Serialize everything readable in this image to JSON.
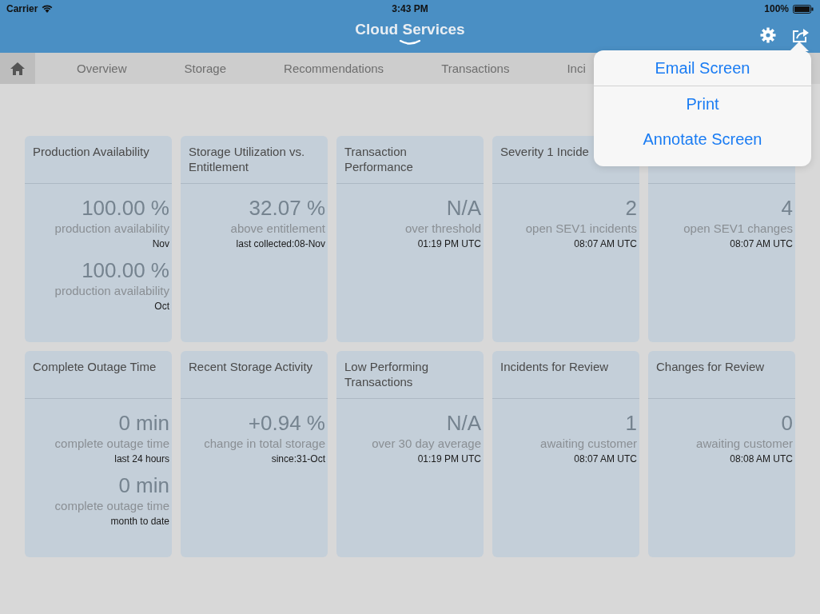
{
  "status_bar": {
    "carrier": "Carrier",
    "time": "3:43 PM",
    "battery": "100%"
  },
  "header": {
    "title": "Cloud Services"
  },
  "tabs": [
    {
      "kind": "home",
      "selected": true
    },
    {
      "kind": "text",
      "label": "Overview",
      "selected": false
    },
    {
      "kind": "text",
      "label": "Storage",
      "selected": false
    },
    {
      "kind": "text",
      "label": "Recommendations",
      "selected": false
    },
    {
      "kind": "text",
      "label": "Transactions",
      "selected": false
    },
    {
      "kind": "text",
      "label": "Inci",
      "selected": false
    }
  ],
  "cards": [
    {
      "title": "Production Availability",
      "metrics": [
        {
          "value": "100.00 %",
          "label": "production availability",
          "note": "Nov"
        },
        {
          "value": "100.00 %",
          "label": "production availability",
          "note": "Oct"
        }
      ]
    },
    {
      "title": "Storage Utilization vs. Entitlement",
      "metrics": [
        {
          "value": "32.07 %",
          "label": "above entitlement",
          "note": "last collected:08-Nov"
        }
      ]
    },
    {
      "title": "Transaction Performance",
      "metrics": [
        {
          "value": "N/A",
          "label": "over threshold",
          "note": "01:19 PM UTC"
        }
      ]
    },
    {
      "title": "Severity 1 Incide",
      "metrics": [
        {
          "value": "2",
          "label": "open SEV1 incidents",
          "note": "08:07 AM UTC"
        }
      ]
    },
    {
      "metrics": [
        {
          "value": "4",
          "label": "open SEV1 changes",
          "note": "08:07 AM UTC"
        }
      ]
    },
    {
      "title": "Complete Outage Time",
      "metrics": [
        {
          "value": "0 min",
          "label": "complete outage time",
          "note": "last 24 hours"
        },
        {
          "value": "0 min",
          "label": "complete outage time",
          "note": "month to date"
        }
      ]
    },
    {
      "title": "Recent Storage Activity",
      "metrics": [
        {
          "value": "+0.94 %",
          "label": "change in total storage",
          "note": "since:31-Oct"
        }
      ]
    },
    {
      "title": "Low Performing Transactions",
      "metrics": [
        {
          "value": "N/A",
          "label": "over 30 day average",
          "note": "01:19 PM UTC"
        }
      ]
    },
    {
      "title": "Incidents for Review",
      "metrics": [
        {
          "value": "1",
          "label": "awaiting customer",
          "note": "08:07 AM UTC"
        }
      ]
    },
    {
      "title": "Changes for Review",
      "metrics": [
        {
          "value": "0",
          "label": "awaiting customer",
          "note": "08:08 AM UTC"
        }
      ]
    }
  ],
  "popover": {
    "items": [
      "Email Screen",
      "Print",
      "Annotate Screen"
    ]
  }
}
